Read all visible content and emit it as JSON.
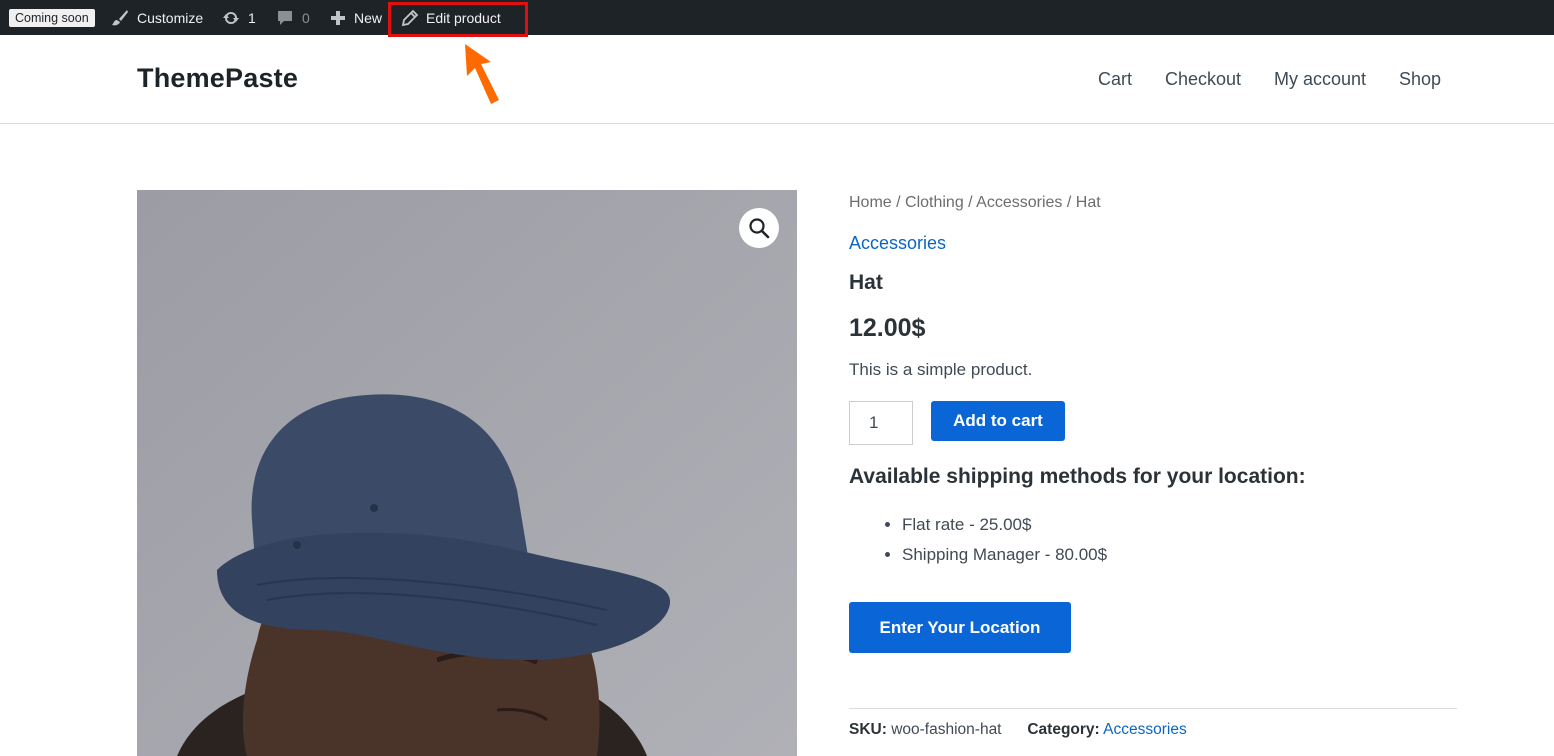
{
  "admin_bar": {
    "coming_soon": "Coming soon",
    "customize": "Customize",
    "updates_count": "1",
    "comments_count": "0",
    "new": "New",
    "edit_product": "Edit product"
  },
  "header": {
    "site_title": "ThemePaste",
    "nav": [
      "Cart",
      "Checkout",
      "My account",
      "Shop"
    ]
  },
  "product": {
    "breadcrumb": "Home / Clothing / Accessories / Hat",
    "category_link": "Accessories",
    "title": "Hat",
    "price": "12.00$",
    "short_description": "This is a simple product.",
    "quantity": "1",
    "add_to_cart": "Add to cart",
    "shipping_heading": "Available shipping methods for your location:",
    "shipping_methods": [
      "Flat rate - 25.00$",
      "Shipping Manager - 80.00$"
    ],
    "enter_location": "Enter Your Location",
    "sku_label": "SKU:",
    "sku_value": "woo-fashion-hat",
    "category_label": "Category:",
    "category_value": "Accessories"
  },
  "icons": {
    "customize": "brush-icon",
    "updates": "updates-icon",
    "comments": "comment-icon",
    "new": "plus-icon",
    "edit": "pencil-icon",
    "zoom": "magnifier-icon"
  },
  "colors": {
    "admin_bar": "#1d2327",
    "accent_blue": "#0a66d6",
    "highlight_red": "#e01010",
    "arrow_orange": "#ff6a00"
  }
}
